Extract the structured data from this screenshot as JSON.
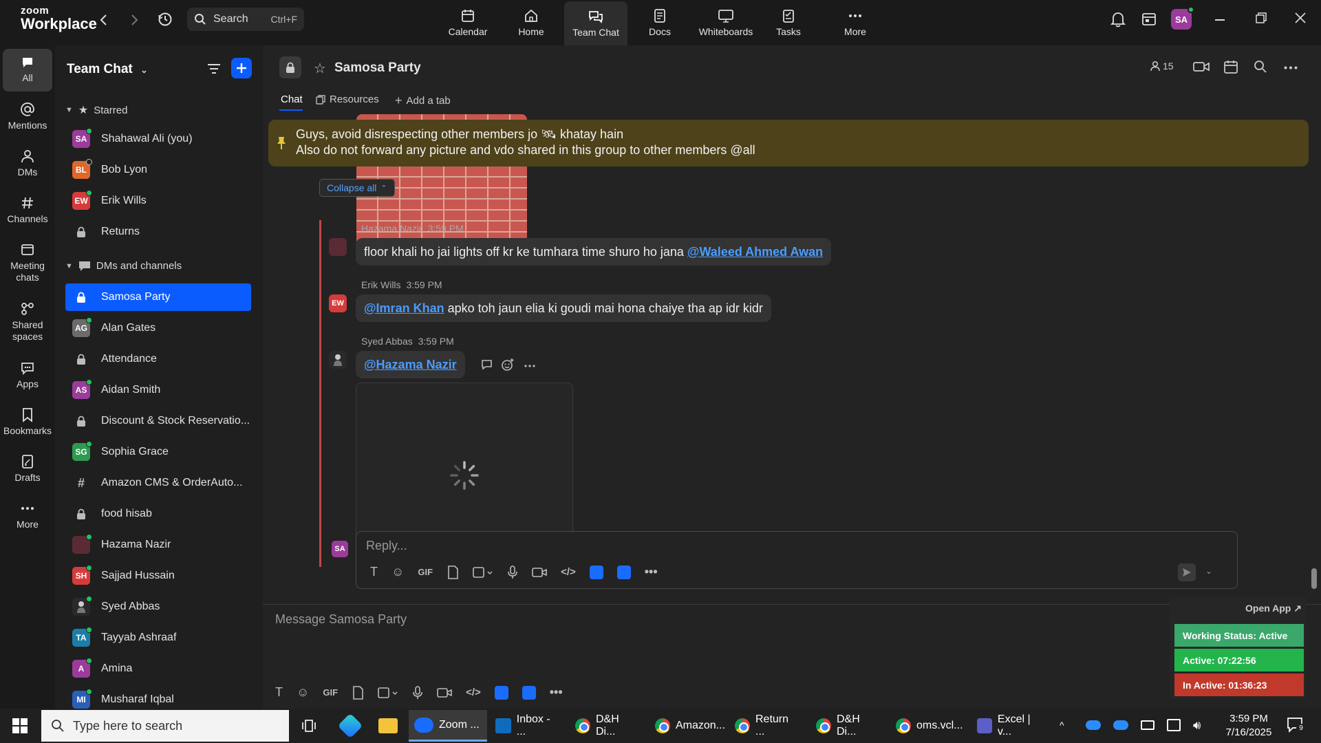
{
  "topbar": {
    "logo_line1": "zoom",
    "logo_line2": "Workplace",
    "search_label": "Search",
    "search_shortcut": "Ctrl+F",
    "nav": [
      {
        "label": "Calendar",
        "icon": "calendar-icon"
      },
      {
        "label": "Home",
        "icon": "home-icon"
      },
      {
        "label": "Team Chat",
        "icon": "chat-icon"
      },
      {
        "label": "Docs",
        "icon": "docs-icon"
      },
      {
        "label": "Whiteboards",
        "icon": "whiteboard-icon"
      },
      {
        "label": "Tasks",
        "icon": "tasks-icon"
      },
      {
        "label": "More",
        "icon": "more-icon"
      }
    ],
    "avatar_initials": "SA"
  },
  "rail": [
    {
      "label": "All"
    },
    {
      "label": "Mentions"
    },
    {
      "label": "DMs"
    },
    {
      "label": "Channels"
    },
    {
      "label": "Meeting chats"
    },
    {
      "label": "Shared spaces"
    },
    {
      "label": "Apps"
    },
    {
      "label": "Bookmarks"
    },
    {
      "label": "Drafts"
    },
    {
      "label": "More"
    }
  ],
  "sidebar": {
    "title": "Team Chat",
    "starred_label": "Starred",
    "starred": [
      {
        "name": "Shahawal Ali (you)",
        "initials": "SA",
        "color": "#9b3b9a"
      },
      {
        "name": "Bob Lyon",
        "initials": "BL",
        "color": "#e0672a"
      },
      {
        "name": "Erik Wills",
        "initials": "EW",
        "color": "#d63b3b"
      },
      {
        "name": "Returns",
        "initials": "",
        "color": ""
      }
    ],
    "dms_label": "DMs and channels",
    "items": [
      {
        "name": "Samosa Party"
      },
      {
        "name": "Alan Gates",
        "initials": "AG",
        "color": "#6b6b6b"
      },
      {
        "name": "Attendance"
      },
      {
        "name": "Aidan Smith",
        "initials": "AS",
        "color": "#9b3b9a"
      },
      {
        "name": "Discount & Stock Reservatio..."
      },
      {
        "name": "Sophia Grace",
        "initials": "SG",
        "color": "#2e9a50"
      },
      {
        "name": "Amazon CMS & OrderAuto..."
      },
      {
        "name": "food hisab"
      },
      {
        "name": "Hazama Nazir",
        "initials": "",
        "color": "#5a2b35"
      },
      {
        "name": "Sajjad Hussain",
        "initials": "SH",
        "color": "#d63b3b"
      },
      {
        "name": "Syed Abbas",
        "initials": "",
        "color": "#2a2a2a"
      },
      {
        "name": "Tayyab Ashraaf",
        "initials": "TA",
        "color": "#1a7fa8"
      },
      {
        "name": "Amina",
        "initials": "A",
        "color": "#9b3b9a"
      },
      {
        "name": "Musharaf Iqbal",
        "initials": "MI",
        "color": "#2a5fb8"
      }
    ]
  },
  "channel": {
    "name": "Samosa Party",
    "member_count": "15",
    "tabs": {
      "chat": "Chat",
      "resources": "Resources",
      "add": "Add a tab"
    },
    "pinned_line1": "Guys, avoid disrespecting other members jo 🛰 khatay hain",
    "pinned_line2": "Also do not forward any picture and vdo shared in this group to other members @all",
    "collapse_all": "Collapse all"
  },
  "messages": [
    {
      "author": "Hazama Nazir",
      "time": "3:59 PM",
      "text": "floor khali ho jai lights off kr ke tumhara time shuro ho jana ",
      "mention": "@Waleed Ahmed Awan",
      "avatar_color": "#5a2b35"
    },
    {
      "author": "Erik Wills",
      "time": "3:59 PM",
      "mention": "@Imran Khan",
      "text": " apko toh jaun elia ki goudi mai hona chaiye tha ap idr kidr",
      "initials": "EW",
      "avatar_color": "#d63b3b"
    },
    {
      "author": "Syed Abbas",
      "time": "3:59 PM",
      "mention": "@Hazama Nazir"
    }
  ],
  "reply": {
    "placeholder": "Reply...",
    "avatar_initials": "SA"
  },
  "composer": {
    "placeholder": "Message Samosa Party"
  },
  "working_status": {
    "open_app": "Open App ↗",
    "status": "Working Status: Active",
    "active": "Active: 07:22:56",
    "inactive": "In Active: 01:36:23"
  },
  "taskbar": {
    "search_placeholder": "Type here to search",
    "apps": [
      {
        "label": "Zoom ..."
      },
      {
        "label": "Inbox - ..."
      },
      {
        "label": "D&H Di..."
      },
      {
        "label": "Amazon..."
      },
      {
        "label": "Return ..."
      },
      {
        "label": "D&H Di..."
      },
      {
        "label": "oms.vcl..."
      },
      {
        "label": "Excel | v..."
      }
    ],
    "time": "3:59 PM",
    "date": "7/16/2025",
    "notif_count": "9"
  }
}
